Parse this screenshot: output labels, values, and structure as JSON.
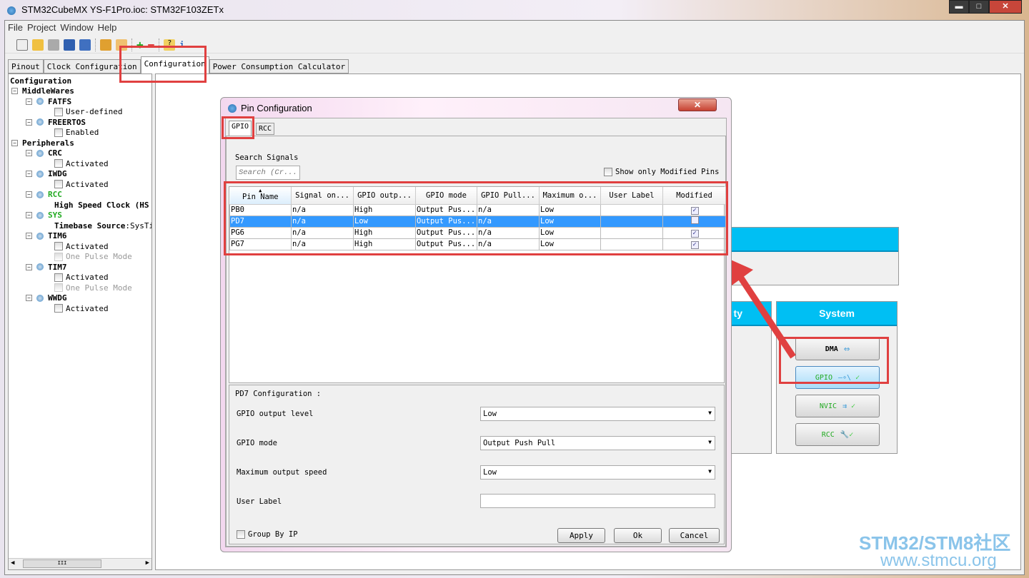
{
  "window": {
    "title": "STM32CubeMX YS-F1Pro.ioc: STM32F103ZETx",
    "minimize": "▬",
    "maximize": "□",
    "close": "✕"
  },
  "menu": [
    "File",
    "Project",
    "Window",
    "Help"
  ],
  "tabs": [
    "Pinout",
    "Clock Configuration",
    "Configuration",
    "Power Consumption Calculator"
  ],
  "active_tab": "Configuration",
  "tree": {
    "root": "Configuration",
    "middlewares": "MiddleWares",
    "fatfs": "FATFS",
    "fatfs_opt": "User-defined",
    "freertos": "FREERTOS",
    "freertos_opt": "Enabled",
    "peripherals": "Peripherals",
    "crc": "CRC",
    "crc_opt": "Activated",
    "iwdg": "IWDG",
    "iwdg_opt": "Activated",
    "rcc": "RCC",
    "rcc_opt": "High Speed Clock (HS",
    "sys": "SYS",
    "sys_opt_key": "Timebase Source",
    "sys_opt_val": ":SysTi",
    "tim6": "TIM6",
    "tim6_opt1": "Activated",
    "tim6_opt2": "One Pulse Mode",
    "tim7": "TIM7",
    "tim7_opt1": "Activated",
    "tim7_opt2": "One Pulse Mode",
    "wwdg": "WWDG",
    "wwdg_opt": "Activated",
    "scroll_thumb": "III"
  },
  "system": {
    "header": "System",
    "partial_header": "ty",
    "buttons": [
      "DMA",
      "GPIO",
      "NVIC",
      "RCC"
    ]
  },
  "dialog": {
    "title": "Pin Configuration",
    "close": "✕",
    "tabs": [
      "GPIO",
      "RCC"
    ],
    "search_label": "Search Signals",
    "search_placeholder": "Search (Cr...",
    "show_modified": "Show only Modified Pins",
    "columns": [
      "Pin Name",
      "Signal on...",
      "GPIO outp...",
      "GPIO mode",
      "GPIO Pull...",
      "Maximum o...",
      "User Label",
      "Modified"
    ],
    "rows": [
      {
        "pin": "PB0",
        "signal": "n/a",
        "output": "High",
        "mode": "Output Pus...",
        "pull": "n/a",
        "speed": "Low",
        "label": "",
        "modified": true
      },
      {
        "pin": "PD7",
        "signal": "n/a",
        "output": "Low",
        "mode": "Output Pus...",
        "pull": "n/a",
        "speed": "Low",
        "label": "",
        "modified": false,
        "selected": true
      },
      {
        "pin": "PG6",
        "signal": "n/a",
        "output": "High",
        "mode": "Output Pus...",
        "pull": "n/a",
        "speed": "Low",
        "label": "",
        "modified": true
      },
      {
        "pin": "PG7",
        "signal": "n/a",
        "output": "High",
        "mode": "Output Pus...",
        "pull": "n/a",
        "speed": "Low",
        "label": "",
        "modified": true
      }
    ],
    "config_title": "PD7 Configuration :",
    "fields": {
      "level_label": "GPIO output level",
      "level": "Low",
      "mode_label": "GPIO mode",
      "mode": "Output Push Pull",
      "speed_label": "Maximum output speed",
      "speed": "Low",
      "user_label": "User Label",
      "user_value": ""
    },
    "group_by_ip": "Group By IP",
    "apply": "Apply",
    "ok": "Ok",
    "cancel": "Cancel"
  },
  "watermark": {
    "line1": "STM32/STM8社区",
    "line2": "www.stmcu.org"
  },
  "colors": {
    "accent": "#00bff3",
    "selection": "#3399ff",
    "highlight": "#e04040",
    "enabled_green": "#22aa22"
  }
}
